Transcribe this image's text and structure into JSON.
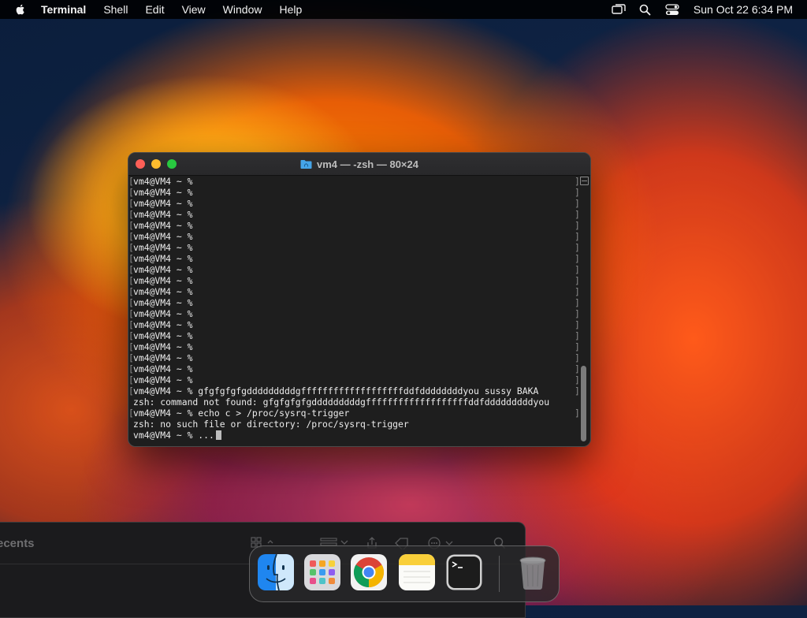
{
  "menubar": {
    "app_name": "Terminal",
    "items": [
      "Shell",
      "Edit",
      "View",
      "Window",
      "Help"
    ],
    "clock": "Sun Oct 22  6:34 PM",
    "icons": [
      "apple-icon",
      "screen-mirroring-icon",
      "spotlight-search-icon",
      "control-center-icon"
    ]
  },
  "terminal": {
    "title": "vm4 — -zsh — 80×24",
    "lines": [
      "vm4@VM4 ~ %",
      "vm4@VM4 ~ %",
      "vm4@VM4 ~ %",
      "vm4@VM4 ~ %",
      "vm4@VM4 ~ %",
      "vm4@VM4 ~ %",
      "vm4@VM4 ~ %",
      "vm4@VM4 ~ %",
      "vm4@VM4 ~ %",
      "vm4@VM4 ~ %",
      "vm4@VM4 ~ %",
      "vm4@VM4 ~ %",
      "vm4@VM4 ~ %",
      "vm4@VM4 ~ %",
      "vm4@VM4 ~ %",
      "vm4@VM4 ~ %",
      "vm4@VM4 ~ %",
      "vm4@VM4 ~ %",
      "vm4@VM4 ~ %",
      "vm4@VM4 ~ % gfgfgfgfgdddddddddgfffffffffffffffffffddfddddddddyou sussy BAKA",
      "zsh: command not found: gfgfgfgfgdddddddddgfffffffffffffffffffddfdddddddddyou",
      "vm4@VM4 ~ % echo c > /proc/sysrq-trigger",
      "zsh: no such file or directory: /proc/sysrq-trigger",
      "vm4@VM4 ~ % ..."
    ],
    "bracketed_lines": [
      true,
      true,
      true,
      true,
      true,
      true,
      true,
      true,
      true,
      true,
      true,
      true,
      true,
      true,
      true,
      true,
      true,
      true,
      true,
      true,
      false,
      true,
      false,
      false
    ]
  },
  "background_window": {
    "title": "ecents"
  },
  "dock": {
    "apps": [
      "Finder",
      "Launchpad",
      "Google Chrome",
      "Notes",
      "Terminal",
      "Trash"
    ]
  }
}
